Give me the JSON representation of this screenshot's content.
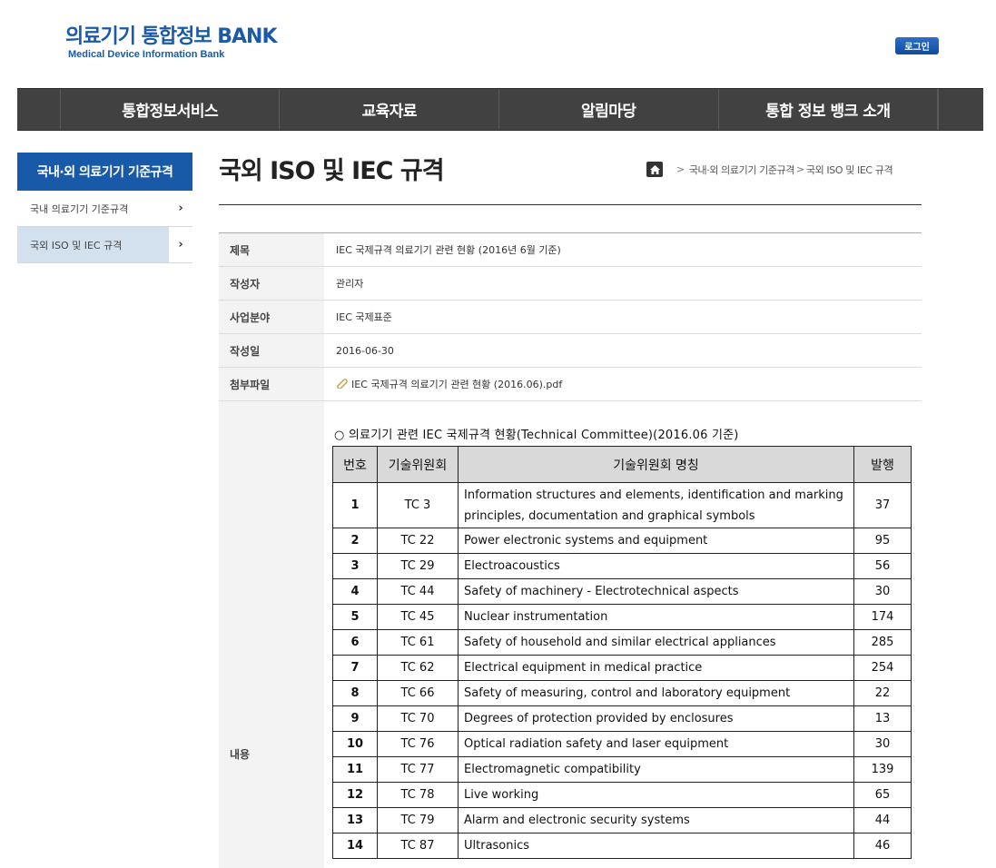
{
  "header": {
    "logo_main": "의료기기 통합정보 BANK",
    "logo_sub": "Medical Device Information Bank",
    "login_label": "로그인"
  },
  "nav": {
    "items": [
      "통합정보서비스",
      "교육자료",
      "알림마당",
      "통합 정보 뱅크 소개"
    ]
  },
  "sidebar": {
    "title": "국내·외 의료기기 기준규격",
    "items": [
      {
        "label": "국내 의료기기 기준규격",
        "active": false
      },
      {
        "label": "국외 ISO 및 IEC 규격",
        "active": true
      }
    ]
  },
  "page": {
    "title": "국외 ISO 및 IEC 규격",
    "breadcrumb": [
      "국내·외 의료기기 기준규격",
      "국외 ISO 및 IEC 규격"
    ]
  },
  "post": {
    "fields": [
      {
        "label": "제목",
        "value": "IEC 국제규격 의료기기 관련 현황 (2016년 6월 기준)"
      },
      {
        "label": "작성자",
        "value": "관리자"
      },
      {
        "label": "사업분야",
        "value": "IEC 국제표준"
      },
      {
        "label": "작성일",
        "value": "2016-06-30"
      },
      {
        "label": "첨부파일",
        "value": "IEC 국제규격 의료기기 관련 현황 (2016.06).pdf"
      }
    ],
    "content_label": "내용",
    "content": {
      "caption": "○ 의료기기 관련 IEC 국제규격 현황(Technical Committee)(2016.06 기준)",
      "columns": [
        "번호",
        "기술위원회",
        "기술위원회 명칭",
        "발행"
      ],
      "rows": [
        {
          "no": "1",
          "tc": "TC 3",
          "name": "Information structures and elements, identification and marking principles, documentation and graphical symbols",
          "pub": "37"
        },
        {
          "no": "2",
          "tc": "TC 22",
          "name": "Power electronic systems and equipment",
          "pub": "95"
        },
        {
          "no": "3",
          "tc": "TC 29",
          "name": "Electroacoustics",
          "pub": "56"
        },
        {
          "no": "4",
          "tc": "TC 44",
          "name": "Safety of machinery - Electrotechnical aspects",
          "pub": "30"
        },
        {
          "no": "5",
          "tc": "TC 45",
          "name": "Nuclear instrumentation",
          "pub": "174"
        },
        {
          "no": "6",
          "tc": "TC 61",
          "name": "Safety of household and similar electrical appliances",
          "pub": "285"
        },
        {
          "no": "7",
          "tc": "TC 62",
          "name": "Electrical equipment in medical practice",
          "pub": "254"
        },
        {
          "no": "8",
          "tc": "TC 66",
          "name": "Safety of measuring, control and laboratory equipment",
          "pub": "22"
        },
        {
          "no": "9",
          "tc": "TC 70",
          "name": "Degrees of protection provided by enclosures",
          "pub": "13"
        },
        {
          "no": "10",
          "tc": "TC 76",
          "name": "Optical radiation safety and laser equipment",
          "pub": "30"
        },
        {
          "no": "11",
          "tc": "TC 77",
          "name": "Electromagnetic compatibility",
          "pub": "139"
        },
        {
          "no": "12",
          "tc": "TC 78",
          "name": "Live working",
          "pub": "65"
        },
        {
          "no": "13",
          "tc": "TC 79",
          "name": "Alarm and electronic security systems",
          "pub": "44"
        },
        {
          "no": "14",
          "tc": "TC 87",
          "name": "Ultrasonics",
          "pub": "46"
        }
      ]
    }
  },
  "colors": {
    "brand": "#1a5aa8",
    "nav_bg": "#414141",
    "sidebar_active": "#d3e0ee"
  }
}
